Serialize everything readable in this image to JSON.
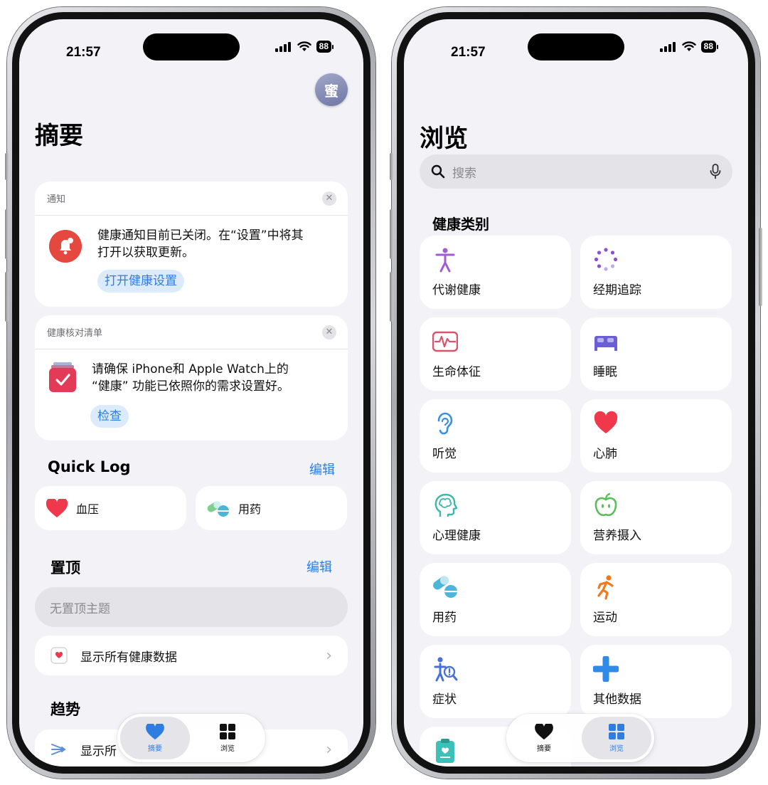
{
  "status": {
    "time": "21:57",
    "battery": "88"
  },
  "summary": {
    "avatar_initial": "蜜",
    "title": "摘要",
    "notification": {
      "header": "通知",
      "text_line1": "健康通知目前已关闭。在“设置”中将其",
      "text_line2": "打开以获取更新。",
      "button": "打开健康设置"
    },
    "checklist": {
      "header": "健康核对清单",
      "text_line1": "请确保 iPhone和 Apple Watch上的",
      "text_line2": "“健康” 功能已依照你的需求设置好。",
      "button": "检查"
    },
    "quick_log": {
      "title": "Quick Log",
      "edit": "编辑",
      "items": [
        {
          "label": "血压",
          "icon": "heart-icon"
        },
        {
          "label": "用药",
          "icon": "pills-icon"
        }
      ]
    },
    "pinned": {
      "title": "置顶",
      "edit": "编辑",
      "empty": "无置顶主题"
    },
    "show_all": "显示所有健康数据",
    "trends": {
      "title": "趋势",
      "row_label": "显示所"
    }
  },
  "browse": {
    "title": "浏览",
    "search_placeholder": "搜索",
    "categories_title": "健康类别",
    "categories": [
      {
        "label": "代谢健康",
        "icon": "figure-icon",
        "color": "#a35ad8"
      },
      {
        "label": "经期追踪",
        "icon": "cycle-dots-icon",
        "color": "#8a4fd8"
      },
      {
        "label": "生命体征",
        "icon": "waveform-icon",
        "color": "#d8536b"
      },
      {
        "label": "睡眠",
        "icon": "bed-icon",
        "color": "#6b5fd8"
      },
      {
        "label": "听觉",
        "icon": "ear-icon",
        "color": "#3a8fe0"
      },
      {
        "label": "心肺",
        "icon": "heart-icon",
        "color": "#f0384d"
      },
      {
        "label": "心理健康",
        "icon": "brain-head-icon",
        "color": "#3cb8a8"
      },
      {
        "label": "营养摄入",
        "icon": "apple-icon",
        "color": "#5cbf5c"
      },
      {
        "label": "用药",
        "icon": "pills-icon",
        "color": "#4cb6d8"
      },
      {
        "label": "运动",
        "icon": "running-figure-icon",
        "color": "#f07a1c"
      },
      {
        "label": "症状",
        "icon": "symptom-figure-icon",
        "color": "#4a6fd8"
      },
      {
        "label": "其他数据",
        "icon": "plus-icon",
        "color": "#2f8ae8"
      }
    ]
  },
  "tabbar": {
    "summary_label": "摘要",
    "browse_label": "浏览"
  },
  "colors": {
    "accent": "#2f7de1",
    "background": "#f2f2f7"
  }
}
